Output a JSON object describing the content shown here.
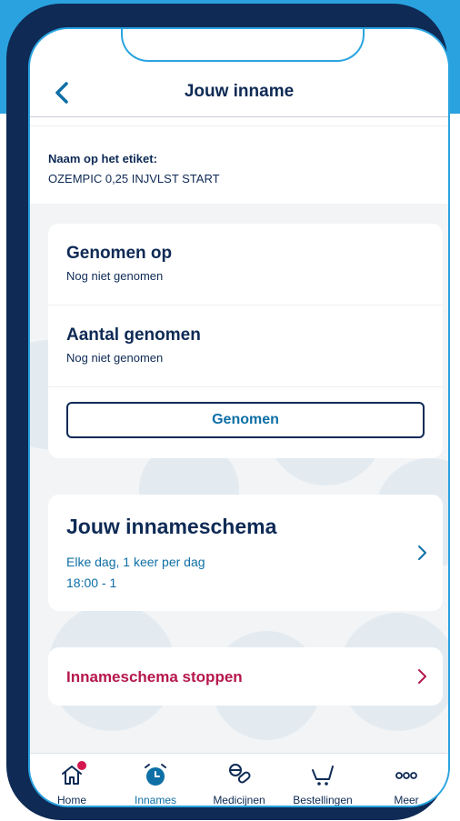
{
  "header": {
    "title": "Jouw inname"
  },
  "label": {
    "heading": "Naam op het etiket:",
    "value": "OZEMPIC 0,25 INJVLST START"
  },
  "intake_card": {
    "taken_on_title": "Genomen op",
    "taken_on_value": "Nog niet genomen",
    "amount_title": "Aantal genomen",
    "amount_value": "Nog niet genomen",
    "button_label": "Genomen"
  },
  "schedule_card": {
    "title": "Jouw innameschema",
    "line1": "Elke dag, 1 keer per dag",
    "line2": "18:00 - 1"
  },
  "stop_card": {
    "title": "Innameschema stoppen"
  },
  "tabbar": {
    "items": [
      {
        "label": "Home",
        "icon": "home-icon"
      },
      {
        "label": "Innames",
        "icon": "alarm-clock-icon"
      },
      {
        "label": "Medicijnen",
        "icon": "pills-icon"
      },
      {
        "label": "Bestellingen",
        "icon": "cart-icon"
      },
      {
        "label": "Meer",
        "icon": "more-icon"
      }
    ],
    "active": "Innames"
  },
  "colors": {
    "navy": "#0e2a55",
    "blue": "#0e6fa6",
    "accent": "#29a4e0",
    "stop_red": "#b5174c",
    "badge": "#d3174f"
  }
}
